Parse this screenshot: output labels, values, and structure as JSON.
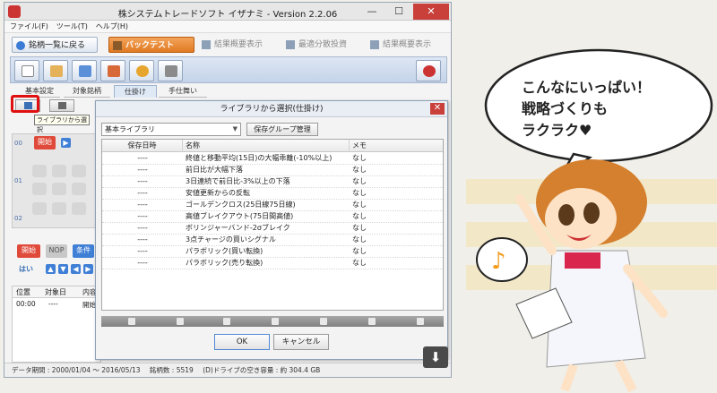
{
  "window": {
    "title": "株システムトレードソフト イザナミ - Version 2.2.06",
    "minimize_label": "—",
    "maximize_label": "☐",
    "close_label": "✕"
  },
  "menu": [
    "ファイル(F)",
    "ツール(T)",
    "ヘルプ(H)"
  ],
  "nav_tabs": [
    {
      "label": "銘柄一覧に戻る"
    },
    {
      "label": "バックテスト"
    },
    {
      "label": "結果概要表示"
    },
    {
      "label": "最適分散投資"
    },
    {
      "label": "結果概要表示"
    }
  ],
  "sub_tabs": [
    "基本設定",
    "対象銘柄",
    "仕掛け",
    "手仕舞い"
  ],
  "tooltip": "ライブラリから選択",
  "left_panel": {
    "row_labels": [
      "00",
      "01",
      "02"
    ],
    "start_label": "開始",
    "start2_label": "開始",
    "nop_label": "NOP",
    "cond_label": "条件",
    "yes_label": "はい",
    "bottom_headers": [
      "位置",
      "対象日",
      "内容"
    ],
    "bottom_row": [
      "00:00",
      "----",
      "開始"
    ]
  },
  "dialog": {
    "title": "ライブラリから選択(仕掛け)",
    "library_select": "基本ライブラリ",
    "group_button": "保存グループ管理",
    "columns": [
      "保存日時",
      "名称",
      "メモ"
    ],
    "rows": [
      {
        "date": "----",
        "name": "終値と移動平均(15日)の大幅乖離(-10%以上)",
        "memo": "なし"
      },
      {
        "date": "----",
        "name": "前日比が大幅下落",
        "memo": "なし"
      },
      {
        "date": "----",
        "name": "3日連続で前日比-3%以上の下落",
        "memo": "なし"
      },
      {
        "date": "----",
        "name": "安値更新からの反転",
        "memo": "なし"
      },
      {
        "date": "----",
        "name": "ゴールデンクロス(25日線75日線)",
        "memo": "なし"
      },
      {
        "date": "----",
        "name": "高値ブレイクアウト(75日間高値)",
        "memo": "なし"
      },
      {
        "date": "----",
        "name": "ボリンジャーバンド-2σブレイク",
        "memo": "なし"
      },
      {
        "date": "----",
        "name": "3点チャージの買いシグナル",
        "memo": "なし"
      },
      {
        "date": "----",
        "name": "パラボリック(買い転換)",
        "memo": "なし"
      },
      {
        "date": "----",
        "name": "パラボリック(売り転換)",
        "memo": "なし"
      }
    ],
    "ok_label": "OK",
    "cancel_label": "キャンセル"
  },
  "status": {
    "period": "データ期間 : 2000/01/04 〜 2016/05/13",
    "count": "銘柄数 : 5519",
    "disk": "(D)ドライブの空き容量 : 約 304.4 GB"
  },
  "illustration": {
    "bubble_lines": [
      "こんなにいっぱい！",
      "戦略づくりも",
      "ラクラク♥"
    ],
    "note_symbol": "♪"
  },
  "colors": {
    "accent_red": "#e01010",
    "blue_button": "#3f7fd6",
    "start_red": "#e04a3a",
    "hair": "#c96a1e",
    "ribbon": "#d9264f"
  }
}
